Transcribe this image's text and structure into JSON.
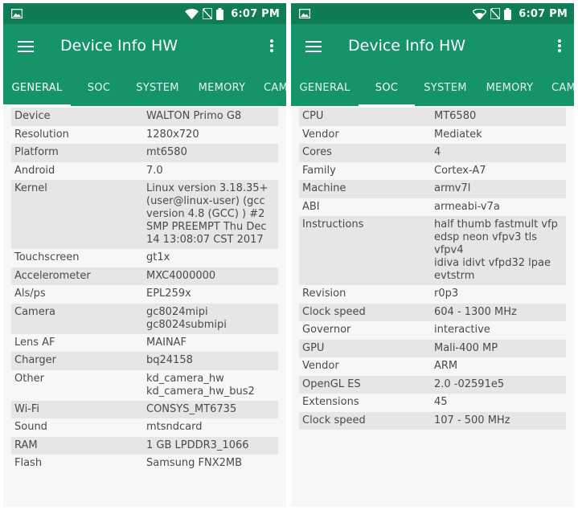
{
  "colors": {
    "status_bar": "#0f7c54",
    "app_bar": "#149468",
    "row_shade": "#e6e6e6",
    "text": "#4a4a4a"
  },
  "screens": [
    {
      "status": {
        "time": "6:07 PM"
      },
      "app_title": "Device Info HW",
      "tabs": [
        "GENERAL",
        "SOC",
        "SYSTEM",
        "MEMORY",
        "CAM"
      ],
      "active_tab": 0,
      "rows": [
        {
          "label": "Device",
          "value": "WALTON Primo G8"
        },
        {
          "label": "Resolution",
          "value": "1280x720"
        },
        {
          "label": "Platform",
          "value": "mt6580"
        },
        {
          "label": "Android",
          "value": "7.0"
        },
        {
          "label": "Kernel",
          "value": "Linux version 3.18.35+\n(user@linux-user) (gcc\nversion 4.8 (GCC) ) #2\nSMP PREEMPT Thu Dec\n14 13:08:07 CST 2017"
        },
        {
          "label": "Touchscreen",
          "value": "gt1x"
        },
        {
          "label": "Accelerometer",
          "value": "MXC4000000"
        },
        {
          "label": "Als/ps",
          "value": "EPL259x"
        },
        {
          "label": "Camera",
          "value": "gc8024mipi\ngc8024submipi"
        },
        {
          "label": "Lens AF",
          "value": "MAINAF"
        },
        {
          "label": "Charger",
          "value": "bq24158"
        },
        {
          "label": "Other",
          "value": "kd_camera_hw\nkd_camera_hw_bus2"
        },
        {
          "label": "Wi-Fi",
          "value": "CONSYS_MT6735"
        },
        {
          "label": "Sound",
          "value": "mtsndcard"
        },
        {
          "label": "RAM",
          "value": "1 GB LPDDR3_1066"
        },
        {
          "label": "Flash",
          "value": "Samsung FNX2MB"
        }
      ]
    },
    {
      "status": {
        "time": "6:07 PM"
      },
      "app_title": "Device Info HW",
      "tabs": [
        "GENERAL",
        "SOC",
        "SYSTEM",
        "MEMORY",
        "CAM"
      ],
      "active_tab": 1,
      "rows": [
        {
          "label": "CPU",
          "value": "MT6580"
        },
        {
          "label": "Vendor",
          "value": "Mediatek"
        },
        {
          "label": "Cores",
          "value": "4"
        },
        {
          "label": "Family",
          "value": "Cortex-A7"
        },
        {
          "label": "Machine",
          "value": "armv7l"
        },
        {
          "label": "ABI",
          "value": "armeabi-v7a"
        },
        {
          "label": "Instructions",
          "value": "half thumb fastmult vfp\nedsp neon vfpv3 tls vfpv4\nidiva idivt vfpd32 lpae\nevtstrm"
        },
        {
          "label": "Revision",
          "value": "r0p3"
        },
        {
          "label": "Clock speed",
          "value": "604 - 1300 MHz"
        },
        {
          "label": "Governor",
          "value": "interactive"
        },
        {
          "label": "GPU",
          "value": "Mali-400 MP"
        },
        {
          "label": "Vendor",
          "value": "ARM"
        },
        {
          "label": "OpenGL ES",
          "value": "2.0 -02591e5"
        },
        {
          "label": "Extensions",
          "value": "45"
        },
        {
          "label": "Clock speed",
          "value": "107 - 500 MHz"
        }
      ]
    }
  ]
}
